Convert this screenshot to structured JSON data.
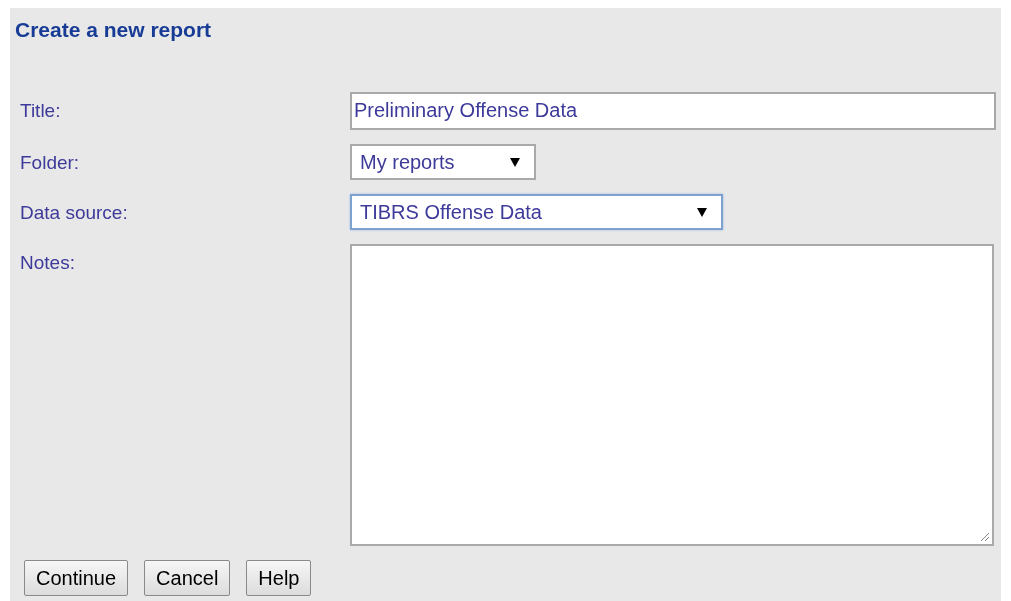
{
  "heading": "Create a new report",
  "fields": [
    {
      "kind": "text",
      "label": "Title:",
      "value": "Preliminary Offense Data",
      "focused": false
    },
    {
      "kind": "select",
      "label": "Folder:",
      "value": "My reports",
      "focused": false
    },
    {
      "kind": "select",
      "label": "Data source:",
      "value": "TIBRS Offense Data",
      "focused": true
    },
    {
      "kind": "textarea",
      "label": "Notes:",
      "focused": false
    }
  ],
  "buttons": [
    "Continue",
    "Cancel",
    "Help"
  ]
}
